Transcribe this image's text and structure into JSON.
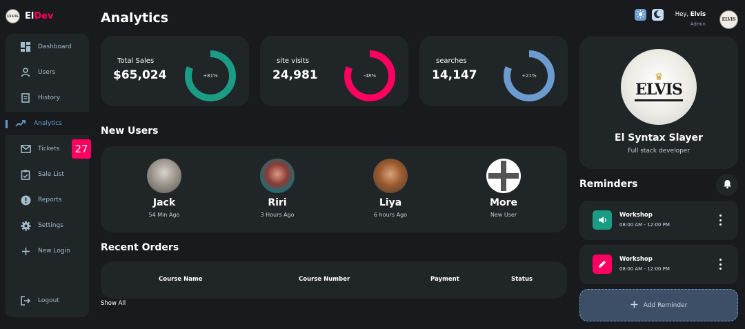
{
  "brand": {
    "name_part1": "El",
    "name_part2": "Dev",
    "logo_text": "ELVIS"
  },
  "sidebar": {
    "items": [
      {
        "label": "Dashboard",
        "icon": "dashboard-icon"
      },
      {
        "label": "Users",
        "icon": "person-icon"
      },
      {
        "label": "History",
        "icon": "receipt-icon"
      },
      {
        "label": "Analytics",
        "icon": "trending-icon",
        "active": true
      },
      {
        "label": "Tickets",
        "icon": "mail-icon",
        "badge": "27"
      },
      {
        "label": "Sale List",
        "icon": "clipboard-icon"
      },
      {
        "label": "Reports",
        "icon": "alert-icon"
      },
      {
        "label": "Settings",
        "icon": "gear-icon"
      },
      {
        "label": "New Login",
        "icon": "plus-icon"
      },
      {
        "label": "Logout",
        "icon": "logout-icon"
      }
    ]
  },
  "main": {
    "title": "Analytics",
    "stats": [
      {
        "label": "Total Sales",
        "value": "$65,024",
        "percent": "+81%",
        "color": "#1b9c85",
        "fill": 0.81
      },
      {
        "label": "site visits",
        "value": "24,981",
        "percent": "-48%",
        "color": "#ff0060",
        "fill": 0.81
      },
      {
        "label": "searches",
        "value": "14,147",
        "percent": "+21%",
        "color": "#6c9bcf",
        "fill": 0.81
      }
    ],
    "new_users_title": "New Users",
    "new_users": [
      {
        "name": "Jack",
        "time": "54 Min Ago"
      },
      {
        "name": "Riri",
        "time": "3 Hours Ago"
      },
      {
        "name": "Liya",
        "time": "6 hours Ago"
      },
      {
        "name": "More",
        "time": "New User"
      }
    ],
    "orders_title": "Recent Orders",
    "orders_columns": [
      "Course Name",
      "Course Number",
      "Payment",
      "Status"
    ],
    "show_all": "Show All"
  },
  "topbar": {
    "greeting": "Hey,",
    "user": "Elvis",
    "role": "Admin"
  },
  "profile": {
    "name": "El Syntax Slayer",
    "role": "Full stack developer"
  },
  "reminders": {
    "title": "Reminders",
    "items": [
      {
        "title": "Workshop",
        "time": "08:00 AM - 12:00 PM",
        "color": "#1b9c85",
        "icon": "volume-icon"
      },
      {
        "title": "Workshop",
        "time": "08:00 AM - 12:00 PM",
        "color": "#ff0060",
        "icon": "edit-icon"
      }
    ],
    "add_label": "Add Reminder"
  }
}
